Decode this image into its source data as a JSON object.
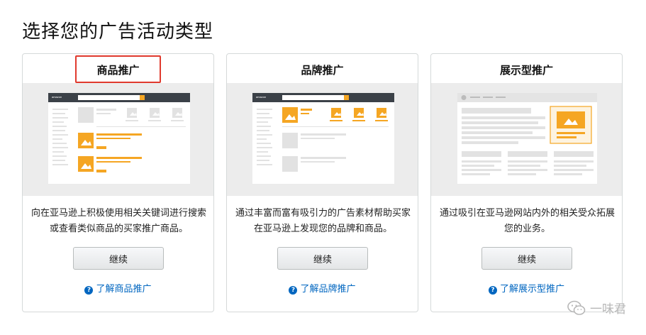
{
  "page": {
    "title": "选择您的广告活动类型"
  },
  "cards": [
    {
      "title": "商品推广",
      "description": "向在亚马逊上积极使用相关关键词进行搜索或查看类似商品的买家推广商品。",
      "button_label": "继续",
      "link_label": "了解商品推广"
    },
    {
      "title": "品牌推广",
      "description": "通过丰富而富有吸引力的广告素材帮助买家在亚马逊上发现您的品牌和商品。",
      "button_label": "继续",
      "link_label": "了解品牌推广"
    },
    {
      "title": "展示型推广",
      "description": "通过吸引在亚马逊网站内外的相关受众拓展您的业务。",
      "button_label": "继续",
      "link_label": "了解展示型推广"
    }
  ],
  "watermark": {
    "text": "一味君"
  },
  "colors": {
    "highlight_border": "#e03a2e",
    "accent_orange": "#f5a623",
    "link_blue": "#0066c0"
  }
}
